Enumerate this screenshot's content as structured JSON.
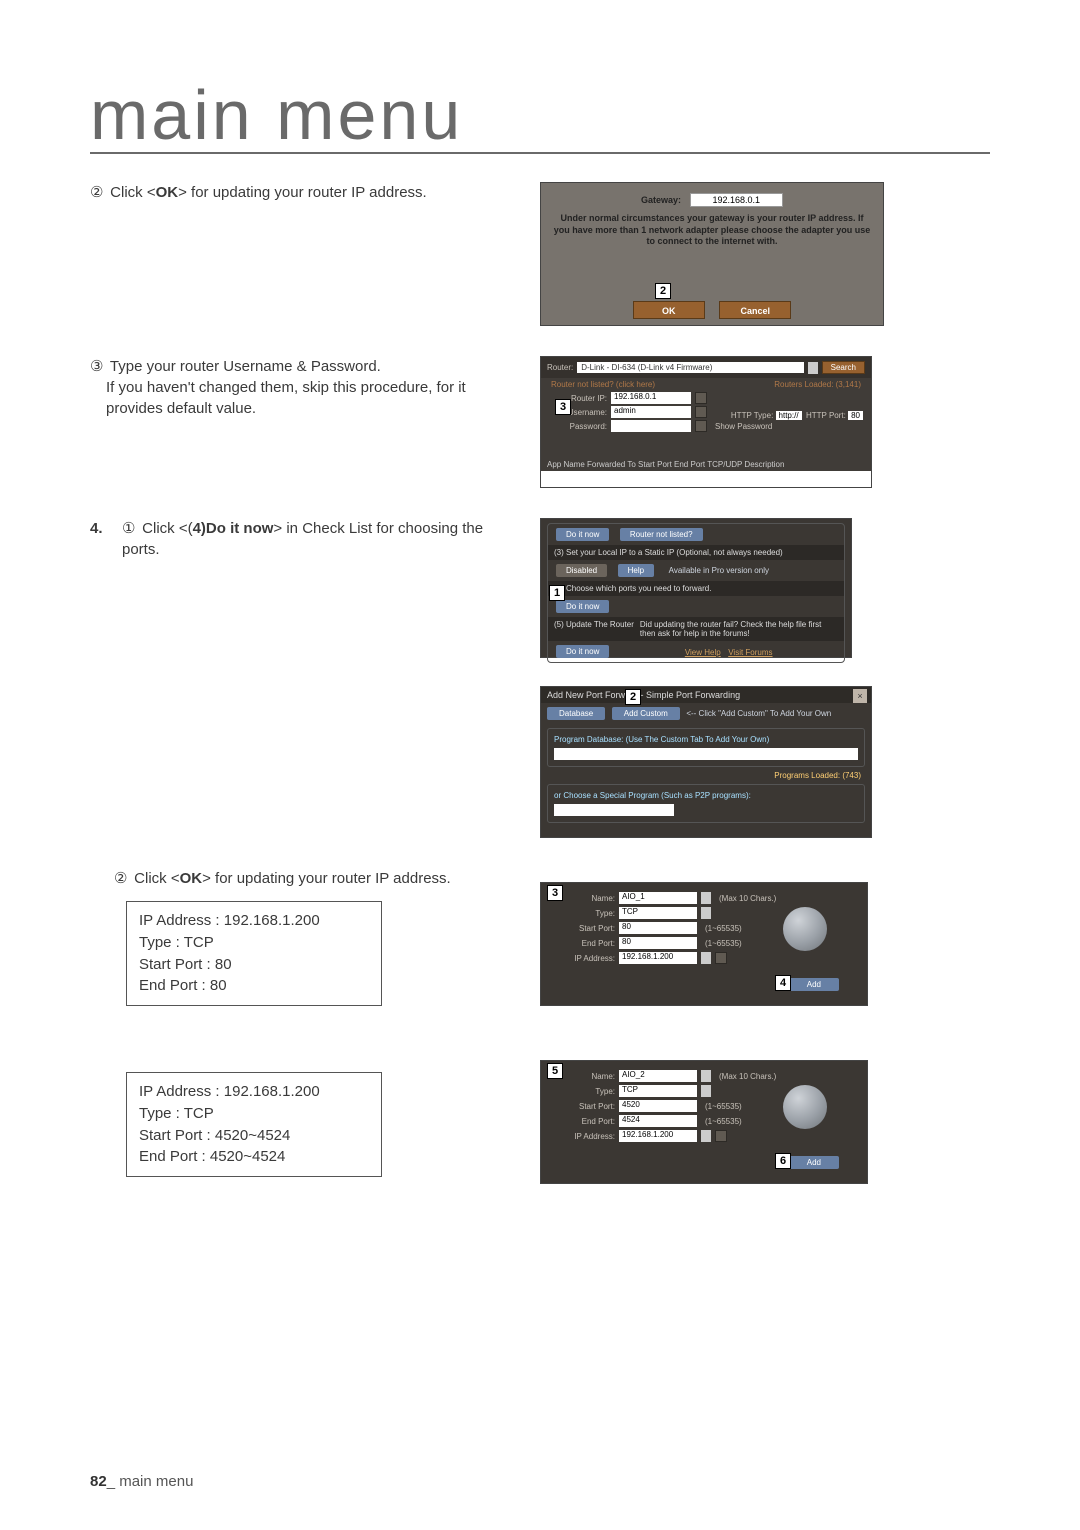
{
  "page": {
    "title": "main menu",
    "footer_num": "82",
    "footer_sep": "_",
    "footer_text": "main menu"
  },
  "steps": {
    "s2": {
      "circ": "②",
      "text_a": " Click <",
      "bold": "OK",
      "text_b": "> for updating your router IP address."
    },
    "s3": {
      "circ": "③",
      "line1": " Type your router Username & Password.",
      "line2": "If you haven't changed them, skip this procedure, for it provides default value."
    },
    "s4": {
      "main": "4.",
      "circ": "①",
      "text_a": " Click <(",
      "bold": "4)Do it now",
      "text_b": "> in Check List for choosing the ports."
    },
    "s4b": {
      "circ": "②",
      "text_a": " Click <",
      "bold": "OK",
      "text_b": "> for updating your router IP address."
    }
  },
  "box1": {
    "l1": "IP Address : 192.168.1.200",
    "l2": "Type : TCP",
    "l3": "Start Port : 80",
    "l4": "End Port : 80"
  },
  "box2": {
    "l1": "IP Address : 192.168.1.200",
    "l2": "Type : TCP",
    "l3": "Start Port : 4520~4524",
    "l4": "End Port : 4520~4524"
  },
  "shot1": {
    "callout": "2",
    "gw_label": "Gateway:",
    "gw_value": "192.168.0.1",
    "msg": "Under normal circumstances your gateway is your router IP address. If you have more than 1 network adapter please choose the adapter you use to connect to the internet with.",
    "ok": "OK",
    "cancel": "Cancel"
  },
  "shot2": {
    "callout": "3",
    "router_lbl": "Router:",
    "router_val": "D-Link - DI-634 (D-Link v4 Firmware)",
    "search": "Search",
    "not_listed": "Router not listed? (click here)",
    "loaded": "Routers Loaded: (3,141)",
    "ip_lbl": "Router IP:",
    "ip_val": "192.168.0.1",
    "user_lbl": "Username:",
    "user_val": "admin",
    "pass_lbl": "Password:",
    "show_pw": "Show Password",
    "http_type": "HTTP Type:",
    "http_val": "http://",
    "http_port_lbl": "HTTP Port:",
    "http_port": "80",
    "cols": "App Name   Forwarded To   Start Port   End Port   TCP/UDP   Description"
  },
  "shot3": {
    "callout": "1",
    "do_it": "Do it now",
    "not_listed": "Router not listed?",
    "row3": "(3) Set your Local IP to a Static IP (Optional, not always needed)",
    "disabled": "Disabled",
    "help": "Help",
    "pro": "Available in Pro version only",
    "row4": "(4) Choose which ports you need to forward.",
    "row5": "(5) Update The Router",
    "fail": "Did updating the router fail? Check the help file first then ask for help in the forums!",
    "view_help": "View Help",
    "forums": "Visit Forums"
  },
  "shot4": {
    "callout": "2",
    "title_a": "Add New Port F",
    "title_b": "orward - Simple Port Forwarding",
    "database": "Database",
    "add_custom": "Add Custom",
    "hint": "<-- Click \"Add Custom\" To Add Your Own",
    "grp1": "Program Database: (Use The Custom Tab To Add Your Own)",
    "loaded": "Programs Loaded: (743)",
    "grp2": "or Choose a Special Program (Such as P2P programs):"
  },
  "shot5": {
    "c_top": "3",
    "c_add": "4",
    "name_lbl": "Name:",
    "name_val": "AIO_1",
    "name_hint": "(Max 10 Chars.)",
    "type_lbl": "Type:",
    "type_val": "TCP",
    "sp_lbl": "Start Port:",
    "sp_val": "80",
    "sp_hint": "(1~65535)",
    "ep_lbl": "End Port:",
    "ep_val": "80",
    "ep_hint": "(1~65535)",
    "ip_lbl": "IP Address:",
    "ip_val": "192.168.1.200",
    "add": "Add"
  },
  "shot6": {
    "c_top": "5",
    "c_add": "6",
    "name_lbl": "Name:",
    "name_val": "AIO_2",
    "name_hint": "(Max 10 Chars.)",
    "type_lbl": "Type:",
    "type_val": "TCP",
    "sp_lbl": "Start Port:",
    "sp_val": "4520",
    "sp_hint": "(1~65535)",
    "ep_lbl": "End Port:",
    "ep_val": "4524",
    "ep_hint": "(1~65535)",
    "ip_lbl": "IP Address:",
    "ip_val": "192.168.1.200",
    "add": "Add"
  }
}
